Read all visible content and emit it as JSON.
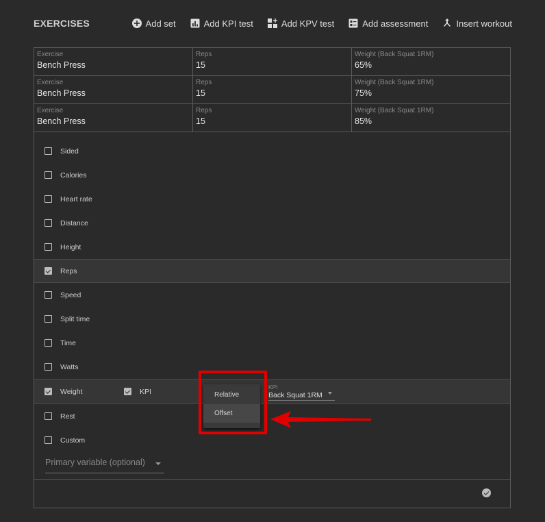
{
  "header": {
    "title": "EXERCISES",
    "actions": [
      {
        "label": "Add set",
        "icon": "add-circle-icon"
      },
      {
        "label": "Add KPI test",
        "icon": "bar-chart-icon"
      },
      {
        "label": "Add KPV test",
        "icon": "grid-add-icon"
      },
      {
        "label": "Add assessment",
        "icon": "assessment-icon"
      },
      {
        "label": "Insert workout",
        "icon": "merge-icon"
      }
    ]
  },
  "sets": [
    {
      "exercise_label": "Exercise",
      "exercise": "Bench Press",
      "reps_label": "Reps",
      "reps": "15",
      "weight_label": "Weight (Back Squat 1RM)",
      "weight": "65%"
    },
    {
      "exercise_label": "Exercise",
      "exercise": "Bench Press",
      "reps_label": "Reps",
      "reps": "15",
      "weight_label": "Weight (Back Squat 1RM)",
      "weight": "75%"
    },
    {
      "exercise_label": "Exercise",
      "exercise": "Bench Press",
      "reps_label": "Reps",
      "reps": "15",
      "weight_label": "Weight (Back Squat 1RM)",
      "weight": "85%"
    }
  ],
  "options": [
    {
      "label": "Sided",
      "checked": false
    },
    {
      "label": "Calories",
      "checked": false
    },
    {
      "label": "Heart rate",
      "checked": false
    },
    {
      "label": "Distance",
      "checked": false
    },
    {
      "label": "Height",
      "checked": false
    },
    {
      "label": "Reps",
      "checked": true
    },
    {
      "label": "Speed",
      "checked": false
    },
    {
      "label": "Split time",
      "checked": false
    },
    {
      "label": "Time",
      "checked": false
    },
    {
      "label": "Watts",
      "checked": false
    },
    {
      "label": "Weight",
      "checked": true
    },
    {
      "label": "Rest",
      "checked": false
    },
    {
      "label": "Custom",
      "checked": false
    }
  ],
  "weight_row": {
    "kpi_check_label": "KPI",
    "kpi_checked": true,
    "kpi_select_label": "KPI",
    "kpi_select_value": "Back Squat 1RM"
  },
  "dropdown": {
    "items": [
      "Relative",
      "Offset"
    ],
    "hovered": "Offset"
  },
  "primary_variable": {
    "placeholder": "Primary variable (optional)"
  },
  "colors": {
    "background": "#2a2a2a",
    "highlight": "#e00000",
    "border": "#5a5a5a"
  }
}
